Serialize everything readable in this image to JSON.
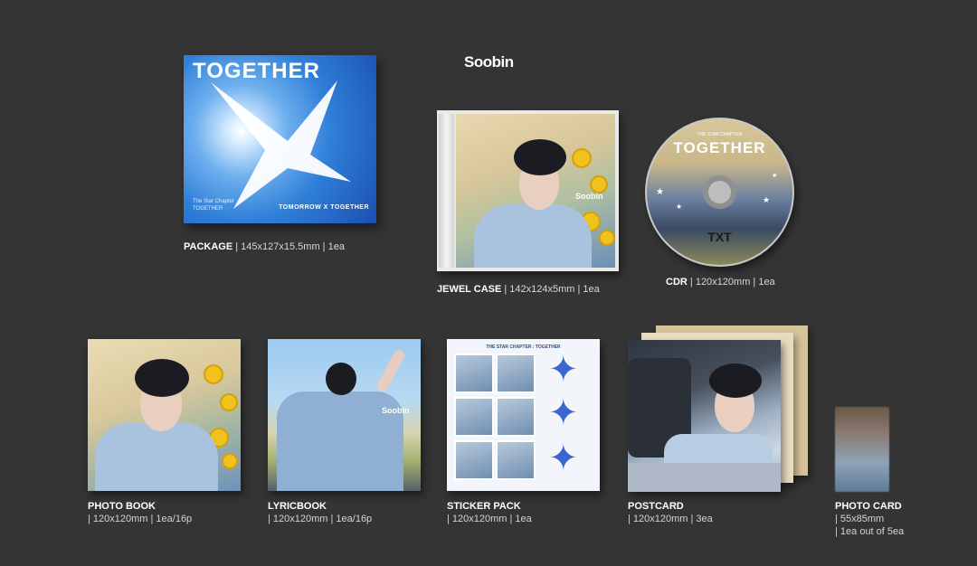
{
  "member_name": "Soobin",
  "package": {
    "cover_title": "TOGETHER",
    "cover_credit": "The Star Chapter TOGETHER",
    "cover_brand": "TOMORROW X TOGETHER",
    "label": "PACKAGE",
    "spec": "| 145x127x15.5mm | 1ea"
  },
  "jewel_case": {
    "label": "JEWEL CASE",
    "spec": "| 142x124x5mm | 1ea",
    "stamp": "Soobin"
  },
  "cdr": {
    "disc_subtitle": "THE STAR CHAPTER",
    "disc_title": "TOGETHER",
    "disc_logo": "TXT",
    "label": "CDR",
    "spec": "| 120x120mm | 1ea"
  },
  "photo_book": {
    "label": "PHOTO BOOK",
    "spec": "| 120x120mm | 1ea/16p"
  },
  "lyricbook": {
    "label": "LYRICBOOK",
    "spec": "| 120x120mm | 1ea/16p",
    "stamp": "Soobin"
  },
  "sticker_pack": {
    "sheet_title": "THE STAR CHAPTER : TOGETHER",
    "label": "STICKER PACK",
    "spec": "| 120x120mm | 1ea"
  },
  "postcard": {
    "label": "POSTCARD",
    "spec": "| 120x120mm | 3ea"
  },
  "photo_card": {
    "label": "PHOTO CARD",
    "spec_line1": "| 55x85mm",
    "spec_line2": "| 1ea out of 5ea"
  }
}
